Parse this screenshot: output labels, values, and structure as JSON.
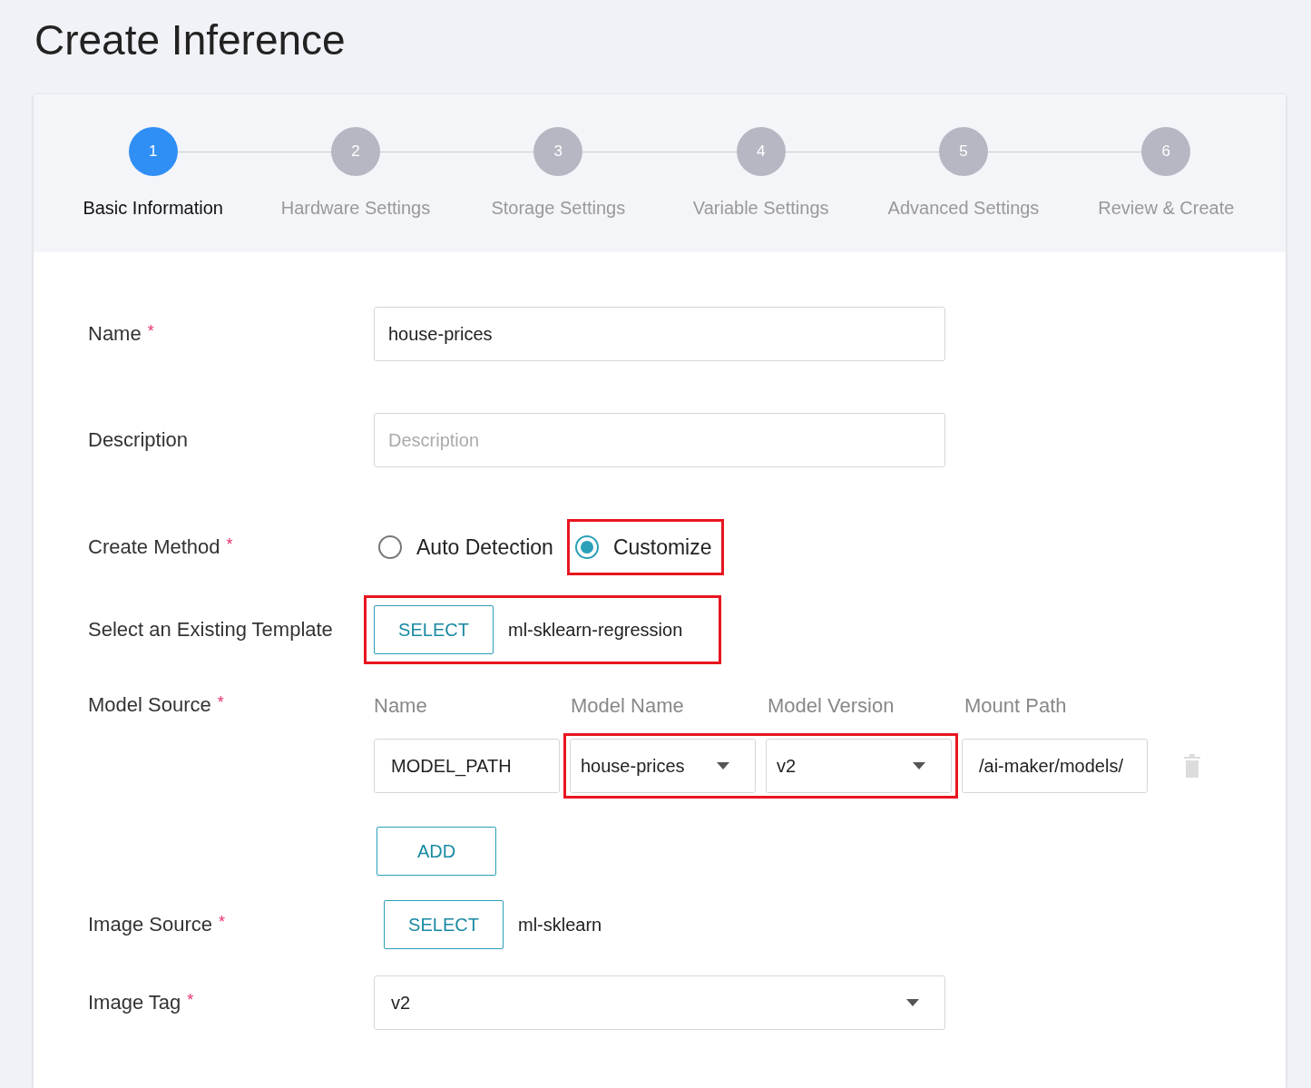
{
  "title": "Create Inference",
  "steps": [
    {
      "number": "1",
      "label": "Basic Information",
      "selected": true
    },
    {
      "number": "2",
      "label": "Hardware Settings",
      "selected": false
    },
    {
      "number": "3",
      "label": "Storage Settings",
      "selected": false
    },
    {
      "number": "4",
      "label": "Variable Settings",
      "selected": false
    },
    {
      "number": "5",
      "label": "Advanced Settings",
      "selected": false
    },
    {
      "number": "6",
      "label": "Review & Create",
      "selected": false
    }
  ],
  "name": {
    "label": "Name",
    "required_mark": "*",
    "value": "house-prices"
  },
  "description": {
    "label": "Description",
    "placeholder": "Description"
  },
  "create_method": {
    "label": "Create Method",
    "required_mark": "*",
    "options": [
      {
        "label": "Auto Detection",
        "selected": false,
        "highlighted": false
      },
      {
        "label": "Customize",
        "selected": true,
        "highlighted": true
      }
    ]
  },
  "template": {
    "label": "Select an Existing Template",
    "button": "SELECT",
    "value": "ml-sklearn-regression",
    "highlighted": true
  },
  "model_source": {
    "label": "Model Source",
    "required_mark": "*",
    "columns": [
      "Name",
      "Model Name",
      "Model Version",
      "Mount Path"
    ],
    "rows": [
      {
        "name": "MODEL_PATH",
        "model_name": "house-prices",
        "model_version": "v2",
        "mount_path": "/ai-maker/models/"
      }
    ],
    "selects_highlighted": true,
    "add_button": "ADD"
  },
  "image_source": {
    "label": "Image Source",
    "required_mark": "*",
    "button": "SELECT",
    "value": "ml-sklearn"
  },
  "image_tag": {
    "label": "Image Tag",
    "required_mark": "*",
    "value": "v2"
  }
}
